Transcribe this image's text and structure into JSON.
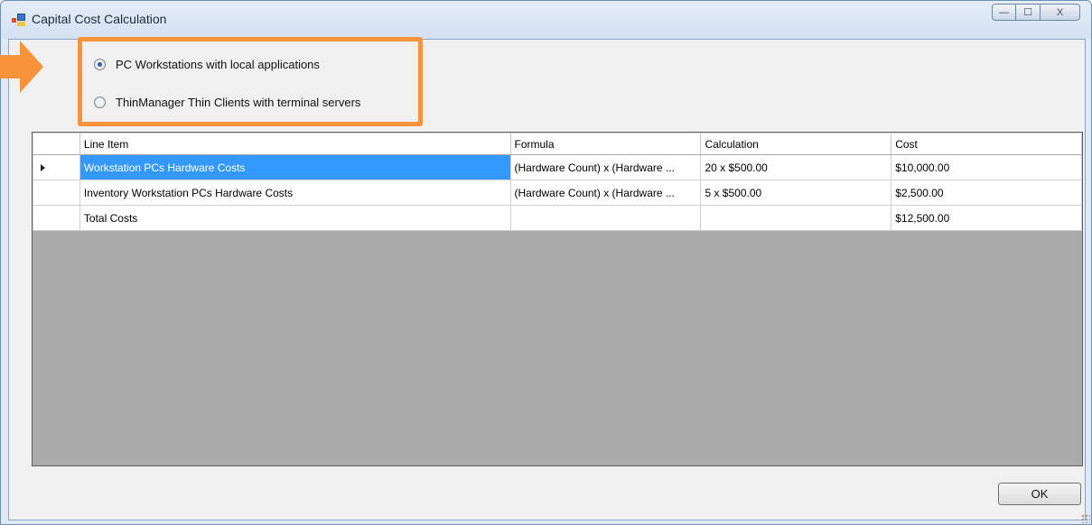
{
  "window": {
    "title": "Capital Cost Calculation",
    "controls": {
      "minimize": "—",
      "maximize": "☐",
      "close": "X"
    }
  },
  "options": [
    {
      "label": "PC Workstations with local applications",
      "checked": true
    },
    {
      "label": "ThinManager Thin Clients with terminal servers",
      "checked": false
    }
  ],
  "grid": {
    "columns": [
      "Line Item",
      "Formula",
      "Calculation",
      "Cost"
    ],
    "rows": [
      {
        "line_item": "Workstation PCs Hardware Costs",
        "formula": "(Hardware Count) x (Hardware ...",
        "calculation": "20 x $500.00",
        "cost": "$10,000.00"
      },
      {
        "line_item": "Inventory Workstation PCs Hardware Costs",
        "formula": "(Hardware Count) x (Hardware ...",
        "calculation": "5 x $500.00",
        "cost": "$2,500.00"
      },
      {
        "line_item": "Total Costs",
        "formula": "",
        "calculation": "",
        "cost": "$12,500.00"
      }
    ]
  },
  "buttons": {
    "ok": "OK"
  },
  "colors": {
    "highlight": "#f7933a",
    "selection": "#3399ff",
    "grid_background": "#ababab"
  }
}
